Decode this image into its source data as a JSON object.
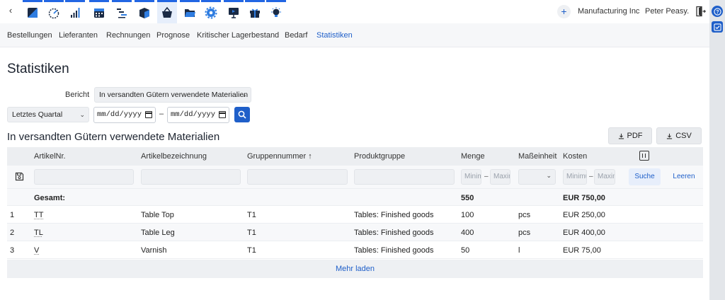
{
  "topbar": {
    "back": "‹",
    "apps": [
      {
        "name": "app-dashboard-icon"
      },
      {
        "name": "app-speedometer-icon"
      },
      {
        "name": "app-bar-chart-icon"
      },
      {
        "name": "app-calendar-icon"
      },
      {
        "name": "app-gantt-icon"
      },
      {
        "name": "app-inventory-box-icon"
      },
      {
        "name": "app-shopping-basket-icon"
      },
      {
        "name": "app-folder-icon"
      },
      {
        "name": "app-settings-gear-icon"
      },
      {
        "name": "app-presentation-icon"
      },
      {
        "name": "app-gift-icon"
      },
      {
        "name": "app-lightbulb-icon"
      }
    ],
    "plus": "+",
    "company": "Manufacturing Inc",
    "user": "Peter Peasy."
  },
  "subnav": [
    {
      "label": "Bestellungen"
    },
    {
      "label": "Lieferanten"
    },
    {
      "label": "Rechnungen"
    },
    {
      "label": "Prognose"
    },
    {
      "label": "Kritischer Lagerbestand"
    },
    {
      "label": "Bedarf"
    },
    {
      "label": "Statistiken",
      "active": true
    }
  ],
  "page": {
    "title": "Statistiken",
    "bericht_label": "Bericht",
    "bericht_value": "In versandten Gütern verwendete Materialien",
    "period_value": "Letztes Quartal",
    "date_from": "mm/dd/yyyy",
    "date_to": "mm/dd/yyyy",
    "date_separator": "–"
  },
  "report": {
    "title": "In versandten Gütern verwendete Materialien",
    "pdf_label": "PDF",
    "csv_label": "CSV"
  },
  "table": {
    "headers": {
      "artikelnr": "ArtikelNr.",
      "bezeichnung": "Artikelbezeichnung",
      "gruppe": "Gruppennummer ↑",
      "produktgruppe": "Produktgruppe",
      "menge": "Menge",
      "einheit": "Maßeinheit",
      "kosten": "Kosten"
    },
    "filters": {
      "min_placeholder": "Minimum",
      "max_placeholder": "Maximum",
      "range_sep": "–",
      "search_label": "Suche",
      "clear_label": "Leeren"
    },
    "total": {
      "label": "Gesamt:",
      "menge": "550",
      "kosten": "EUR 750,00"
    },
    "rows": [
      {
        "no": "1",
        "artikelnr": "TT",
        "bezeichnung": "Table Top",
        "gruppe": "T1",
        "produktgruppe": "Tables: Finished goods",
        "menge": "100",
        "einheit": "pcs",
        "kosten": "EUR 250,00"
      },
      {
        "no": "2",
        "artikelnr": "TL",
        "bezeichnung": "Table Leg",
        "gruppe": "T1",
        "produktgruppe": "Tables: Finished goods",
        "menge": "400",
        "einheit": "pcs",
        "kosten": "EUR 400,00"
      },
      {
        "no": "3",
        "artikelnr": "V",
        "bezeichnung": "Varnish",
        "gruppe": "T1",
        "produktgruppe": "Tables: Finished goods",
        "menge": "50",
        "einheit": "l",
        "kosten": "EUR 75,00"
      }
    ],
    "more_label": "Mehr laden"
  },
  "colors": {
    "accent": "#1f5fc9",
    "app_bar_accent": "#2266e3"
  }
}
